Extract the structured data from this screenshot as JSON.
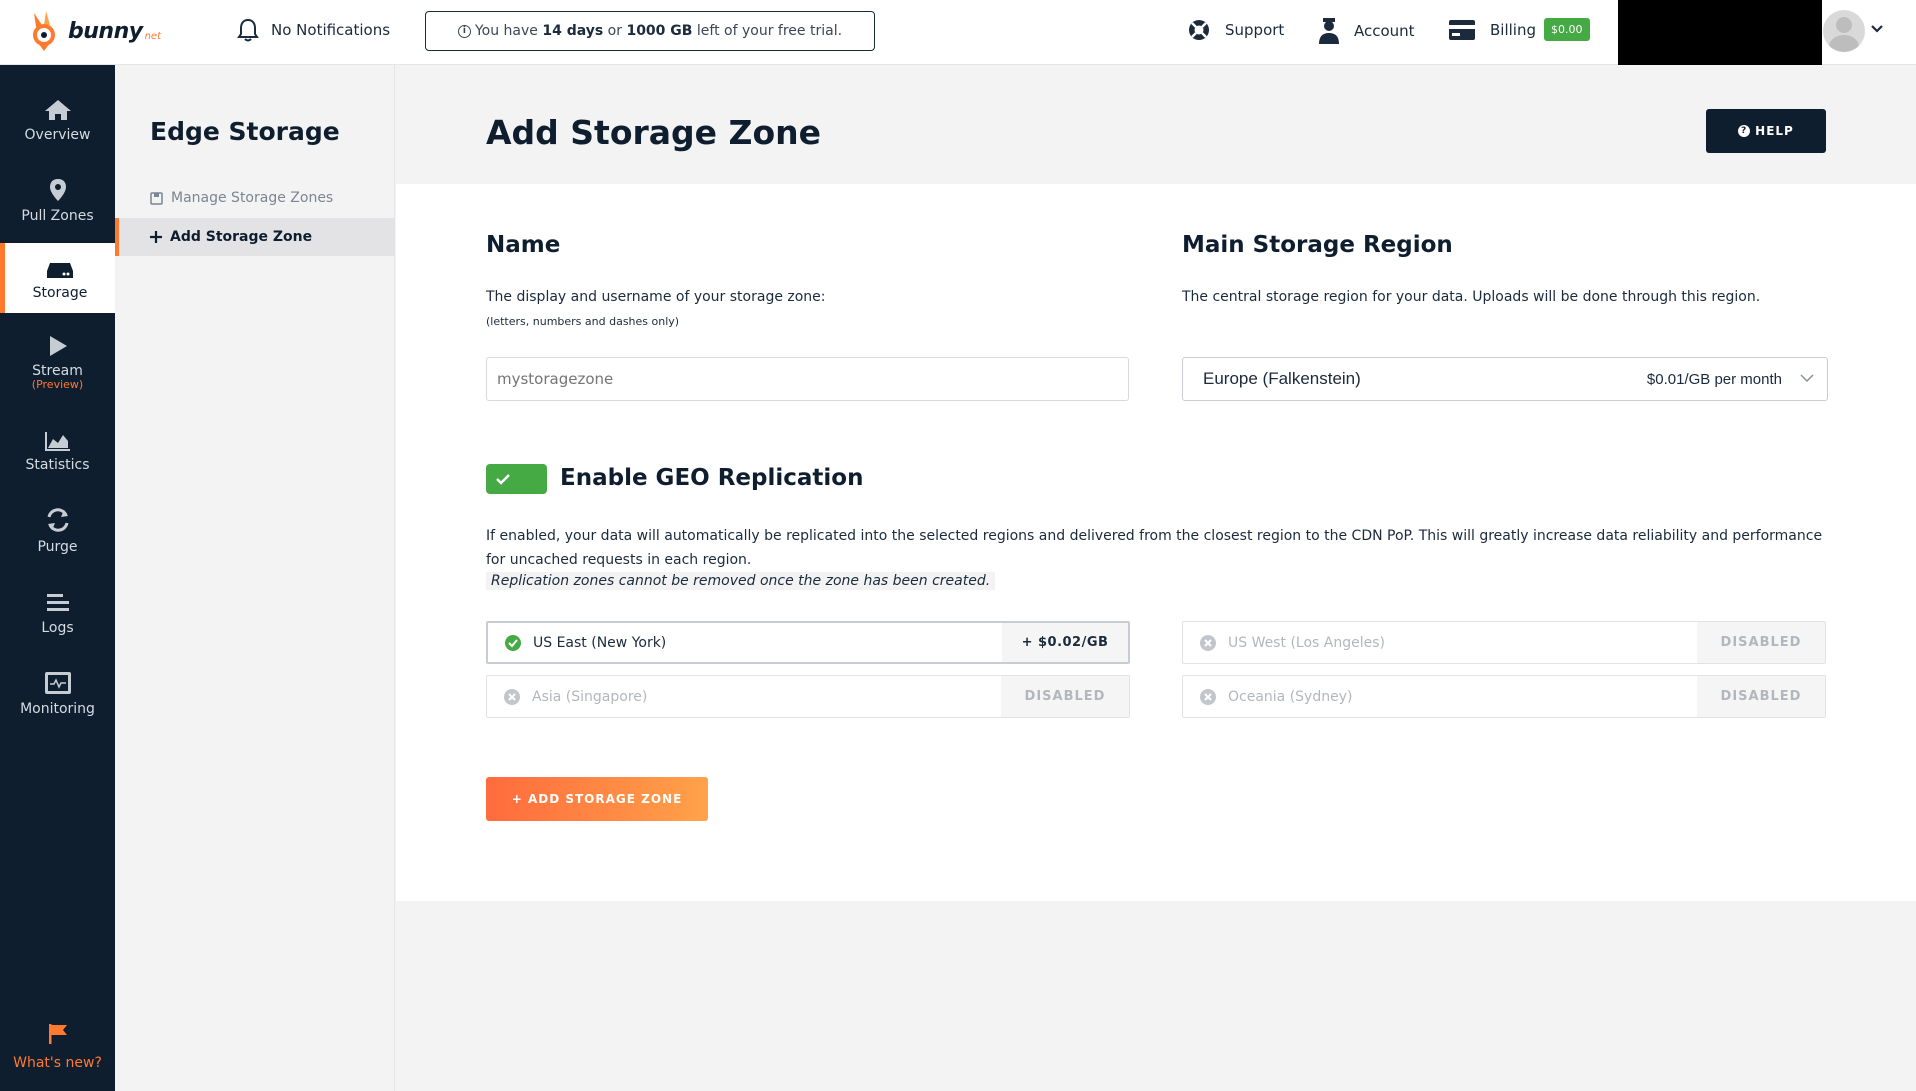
{
  "brand": {
    "name": "bunny",
    "suffix": "net"
  },
  "topbar": {
    "notifications": "No Notifications",
    "trial": {
      "prefix": "You have",
      "days": "14 days",
      "mid": "or",
      "gb": "1000 GB",
      "suffix": "left of your free trial."
    },
    "support": "Support",
    "account": "Account",
    "billing": "Billing",
    "billing_amount": "$0.00"
  },
  "sidebar": {
    "items": [
      {
        "label": "Overview",
        "icon": "home-icon"
      },
      {
        "label": "Pull Zones",
        "icon": "map-pin-icon"
      },
      {
        "label": "Storage",
        "icon": "storage-drive-icon"
      },
      {
        "label": "Stream",
        "sub": "(Preview)",
        "icon": "play-icon"
      },
      {
        "label": "Statistics",
        "icon": "chart-icon"
      },
      {
        "label": "Purge",
        "icon": "refresh-icon"
      },
      {
        "label": "Logs",
        "icon": "list-icon"
      },
      {
        "label": "Monitoring",
        "icon": "monitor-icon"
      }
    ],
    "whats_new": "What's new?"
  },
  "subsidebar": {
    "title": "Edge Storage",
    "links": [
      {
        "label": "Manage Storage Zones"
      },
      {
        "label": "Add Storage Zone"
      }
    ]
  },
  "page": {
    "title": "Add Storage Zone",
    "help": "HELP"
  },
  "form": {
    "name_title": "Name",
    "name_desc": "The display and username of your storage zone:",
    "name_hint": "(letters, numbers and dashes only)",
    "name_placeholder": "mystoragezone",
    "region_title": "Main Storage Region",
    "region_desc": "The central storage region for your data. Uploads will be done through this region.",
    "region_selected": "Europe (Falkenstein)",
    "region_price": "$0.01/GB per month",
    "geo_title": "Enable GEO Replication",
    "geo_desc": "If enabled, your data will automatically be replicated into the selected regions and delivered from the closest region to the CDN PoP. This will greatly increase data reliability and performance for uncached requests in each region.",
    "geo_note": "Replication zones cannot be removed once the zone has been created.",
    "regions": [
      {
        "name": "US East (New York)",
        "price": "+ $0.02/GB",
        "enabled": true
      },
      {
        "name": "US West (Los Angeles)",
        "price": "DISABLED",
        "enabled": false
      },
      {
        "name": "Asia (Singapore)",
        "price": "DISABLED",
        "enabled": false
      },
      {
        "name": "Oceania (Sydney)",
        "price": "DISABLED",
        "enabled": false
      }
    ],
    "submit": "+ ADD STORAGE ZONE"
  },
  "colors": {
    "accent": "#ff7a2f",
    "dark": "#0e1e2f",
    "success": "#45a944"
  }
}
